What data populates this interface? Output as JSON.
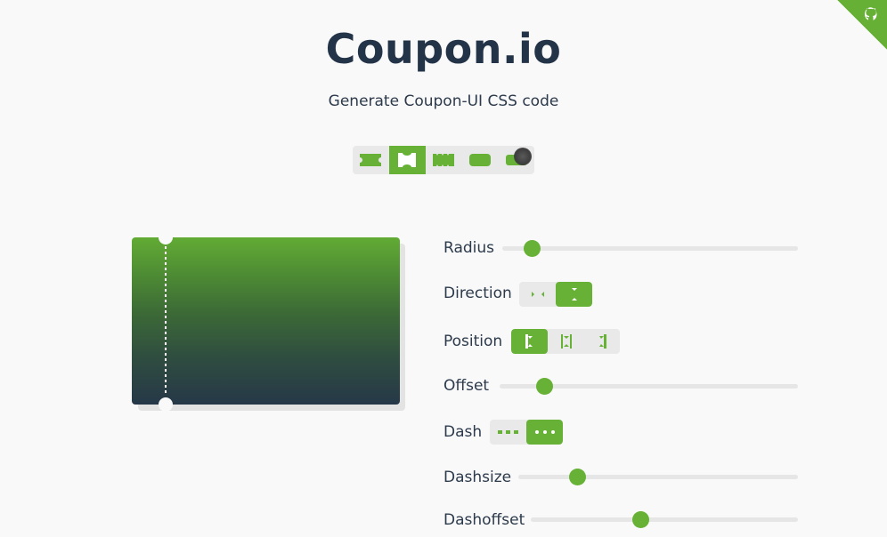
{
  "header": {
    "title": "Coupon.io",
    "subtitle": "Generate Coupon-UI CSS code",
    "corner_icon": "octocat-icon"
  },
  "presets": {
    "items": [
      "preset-side-notches",
      "preset-top-bottom-notches",
      "preset-wave-edges",
      "preset-rounded",
      "preset-blob"
    ],
    "active_index": 1
  },
  "preview": {
    "gradient_top": "#62ab34",
    "gradient_bottom": "#263848",
    "dash_color": "#ffffff"
  },
  "controls": {
    "radius": {
      "label": "Radius",
      "value": 0.1
    },
    "direction": {
      "label": "Direction",
      "options": [
        "horizontal",
        "vertical"
      ],
      "active_index": 1
    },
    "position": {
      "label": "Position",
      "options": [
        "start",
        "center",
        "end"
      ],
      "active_index": 0
    },
    "offset": {
      "label": "Offset",
      "value": 0.15
    },
    "dash": {
      "label": "Dash",
      "options": [
        "dashed",
        "dotted"
      ],
      "active_index": 1
    },
    "dashsize": {
      "label": "Dashsize",
      "value": 0.21
    },
    "dashoffset": {
      "label": "Dashoffset",
      "value": 0.41
    }
  },
  "colors": {
    "accent": "#67b136",
    "track": "#e6e6e6",
    "text": "#2c3a4b"
  }
}
